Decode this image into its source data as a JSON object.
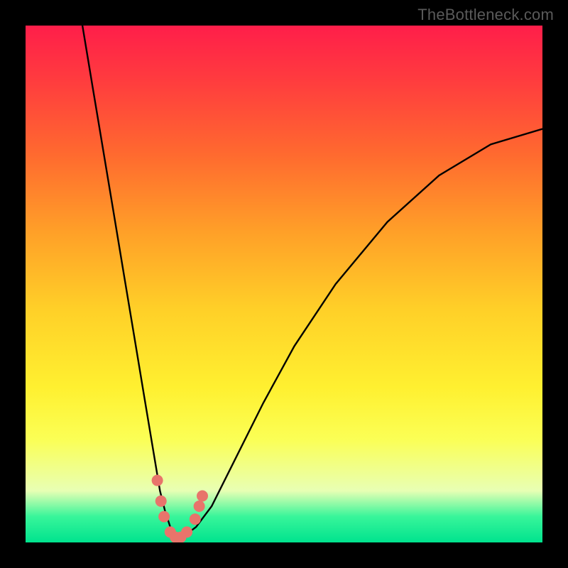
{
  "watermark": "TheBottleneck.com",
  "chart_data": {
    "type": "line",
    "title": "",
    "xlabel": "",
    "ylabel": "",
    "xlim": [
      0,
      100
    ],
    "ylim": [
      0,
      100
    ],
    "series": [
      {
        "name": "bottleneck-curve",
        "x": [
          11,
          13,
          15,
          17,
          19,
          21,
          23,
          25,
          26,
          27,
          28,
          29,
          30,
          31,
          33,
          36,
          40,
          46,
          52,
          60,
          70,
          80,
          90,
          100
        ],
        "y": [
          100,
          88,
          76,
          64,
          52,
          40,
          28,
          16,
          10,
          6,
          3,
          1.5,
          1,
          1.5,
          3,
          7,
          15,
          27,
          38,
          50,
          62,
          71,
          77,
          80
        ]
      }
    ],
    "markers": {
      "name": "highlighted-points",
      "color": "#e8746b",
      "points": [
        {
          "x": 25.5,
          "y": 12
        },
        {
          "x": 26.2,
          "y": 8
        },
        {
          "x": 26.8,
          "y": 5
        },
        {
          "x": 28.0,
          "y": 2
        },
        {
          "x": 29.0,
          "y": 1
        },
        {
          "x": 30.0,
          "y": 1
        },
        {
          "x": 31.2,
          "y": 2
        },
        {
          "x": 32.8,
          "y": 4.5
        },
        {
          "x": 33.6,
          "y": 7
        },
        {
          "x": 34.2,
          "y": 9
        }
      ]
    },
    "gradient_stops": [
      {
        "pos": 0.0,
        "color": "#ff1e4a"
      },
      {
        "pos": 0.1,
        "color": "#ff3a3f"
      },
      {
        "pos": 0.25,
        "color": "#ff6a2f"
      },
      {
        "pos": 0.4,
        "color": "#ffa028"
      },
      {
        "pos": 0.55,
        "color": "#ffd028"
      },
      {
        "pos": 0.7,
        "color": "#fff030"
      },
      {
        "pos": 0.8,
        "color": "#fbff55"
      },
      {
        "pos": 0.9,
        "color": "#e8ffb4"
      },
      {
        "pos": 0.95,
        "color": "#38f59a"
      },
      {
        "pos": 1.0,
        "color": "#00e38e"
      }
    ]
  }
}
